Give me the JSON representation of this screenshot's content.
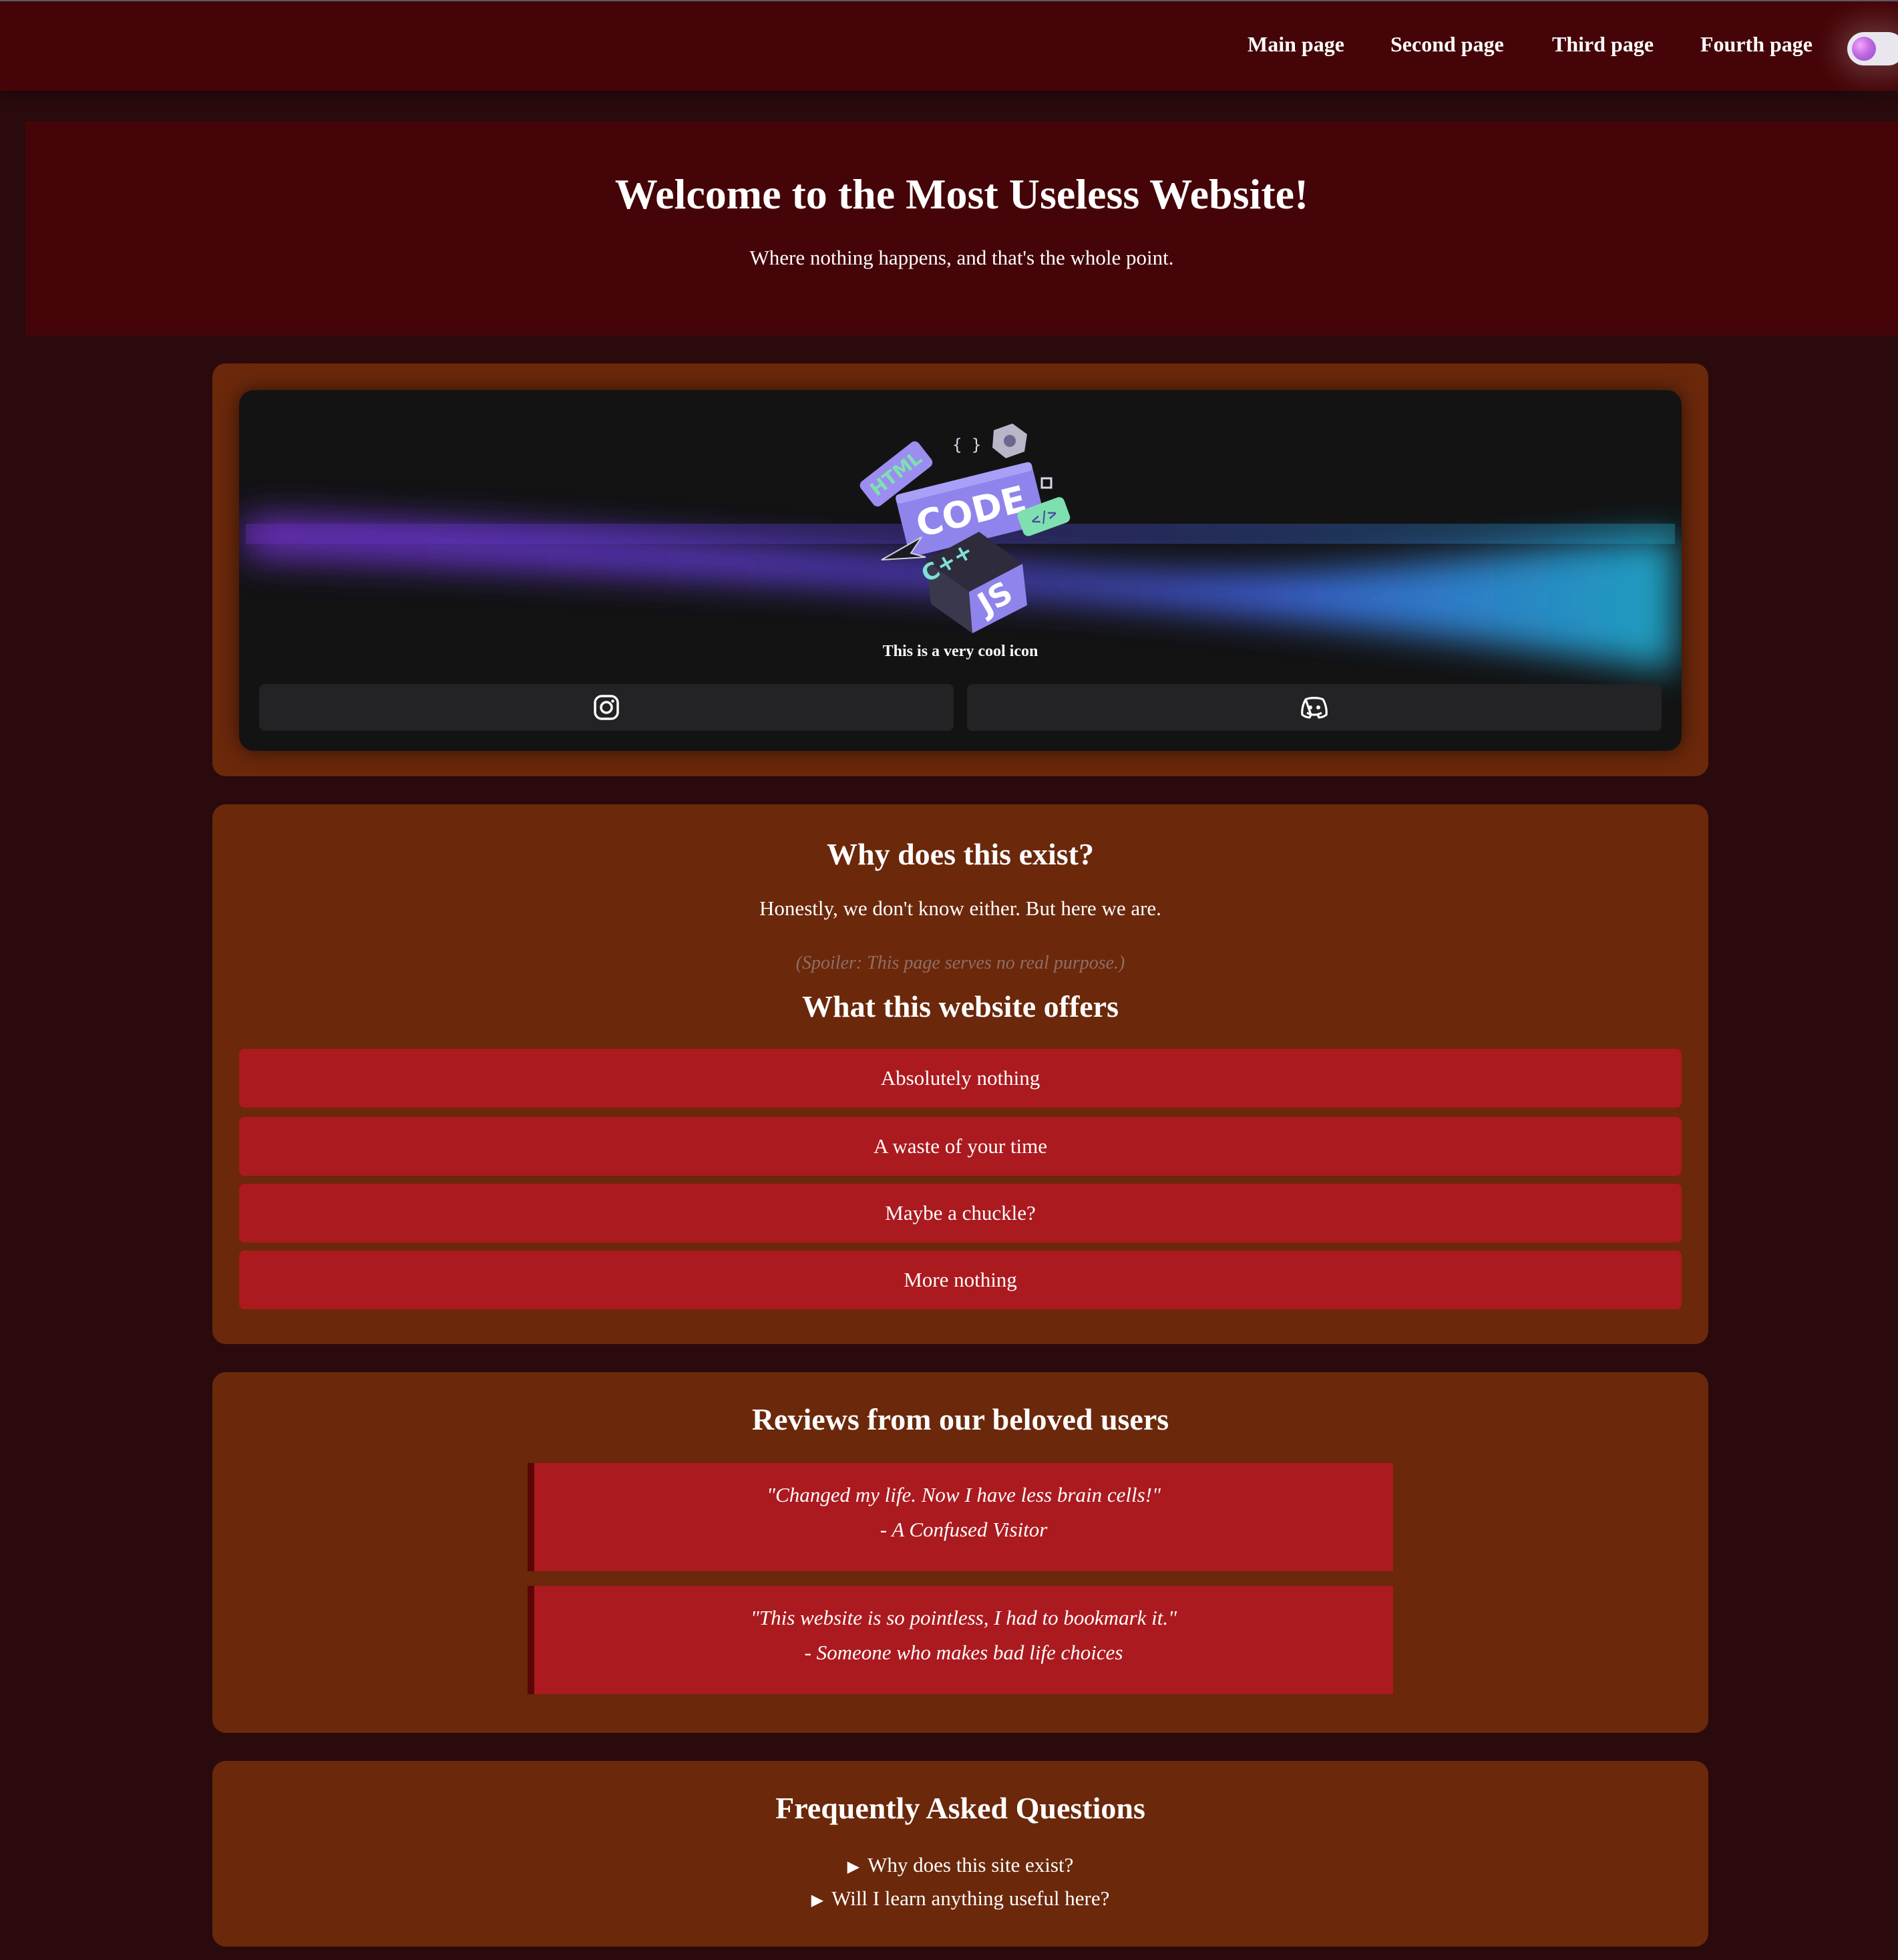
{
  "nav": {
    "links": [
      "Main page",
      "Second page",
      "Third page",
      "Fourth page"
    ]
  },
  "hero": {
    "title": "Welcome to the Most Useless Website!",
    "subtitle": "Where nothing happens, and that's the whole point."
  },
  "profile": {
    "icon_texts": {
      "html": "HTML",
      "code": "CODE",
      "cpp": "C++",
      "js": "JS",
      "braces": "{ }",
      "tag": "</>"
    },
    "caption": "This is a very cool icon",
    "social_icons": [
      "instagram-icon",
      "discord-icon"
    ]
  },
  "about": {
    "title": "Why does this exist?",
    "text": "Honestly, we don't know either. But here we are.",
    "spoiler": "(Spoiler: This page serves no real purpose.)",
    "offers_title": "What this website offers",
    "offers": [
      "Absolutely nothing",
      "A waste of your time",
      "Maybe a chuckle?",
      "More nothing"
    ]
  },
  "reviews": {
    "title": "Reviews from our beloved users",
    "items": [
      {
        "quote": "\"Changed my life. Now I have less brain cells!\"",
        "author": "- A Confused Visitor"
      },
      {
        "quote": "\"This website is so pointless, I had to bookmark it.\"",
        "author": "- Someone who makes bad life choices"
      }
    ]
  },
  "faq": {
    "title": "Frequently Asked Questions",
    "items": [
      "Why does this site exist?",
      "Will I learn anything useful here?"
    ]
  },
  "colors": {
    "navbar": "#450508",
    "page_bg": "#2a0a0d",
    "card": "#6b280b",
    "offer_item": "#ab1a1f",
    "profile_card": "#131314"
  }
}
